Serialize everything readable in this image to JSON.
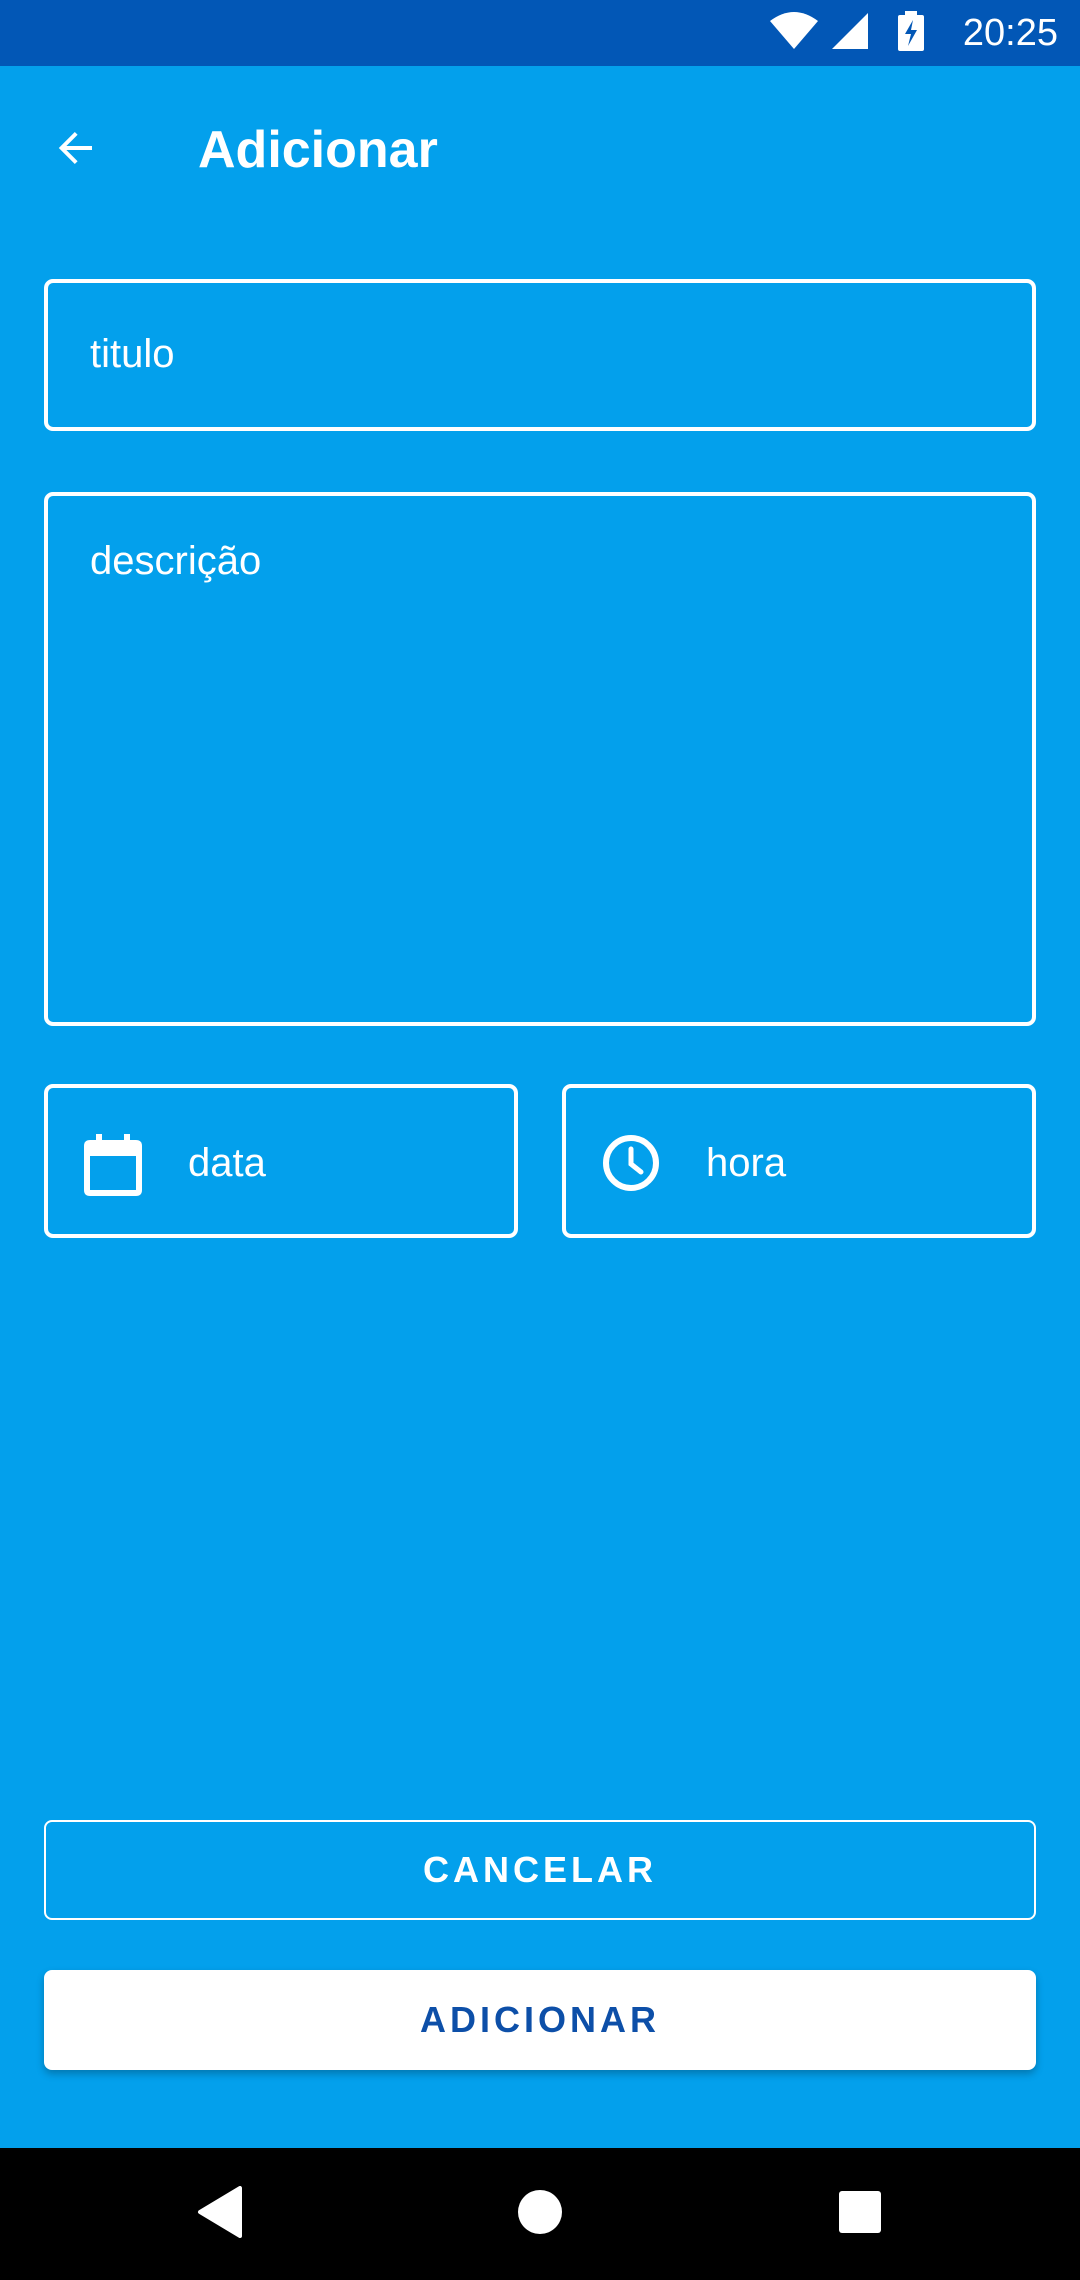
{
  "status_bar": {
    "time": "20:25",
    "icons": [
      "wifi-icon",
      "signal-icon",
      "battery-charging-icon"
    ]
  },
  "app_bar": {
    "title": "Adicionar",
    "back_icon": "arrow-back-icon"
  },
  "form": {
    "titulo_placeholder": "titulo",
    "descricao_placeholder": "descrição",
    "data_placeholder": "data",
    "data_icon": "calendar-icon",
    "hora_placeholder": "hora",
    "hora_icon": "clock-icon"
  },
  "actions": {
    "cancel_label": "CANCELAR",
    "add_label": "ADICIONAR"
  },
  "nav_bar": {
    "icons": [
      "nav-back-icon",
      "nav-home-icon",
      "nav-recents-icon"
    ]
  },
  "colors": {
    "background": "#03A0EC",
    "status_bar": "#0257B6",
    "accent_text": "#0D4FA8"
  }
}
